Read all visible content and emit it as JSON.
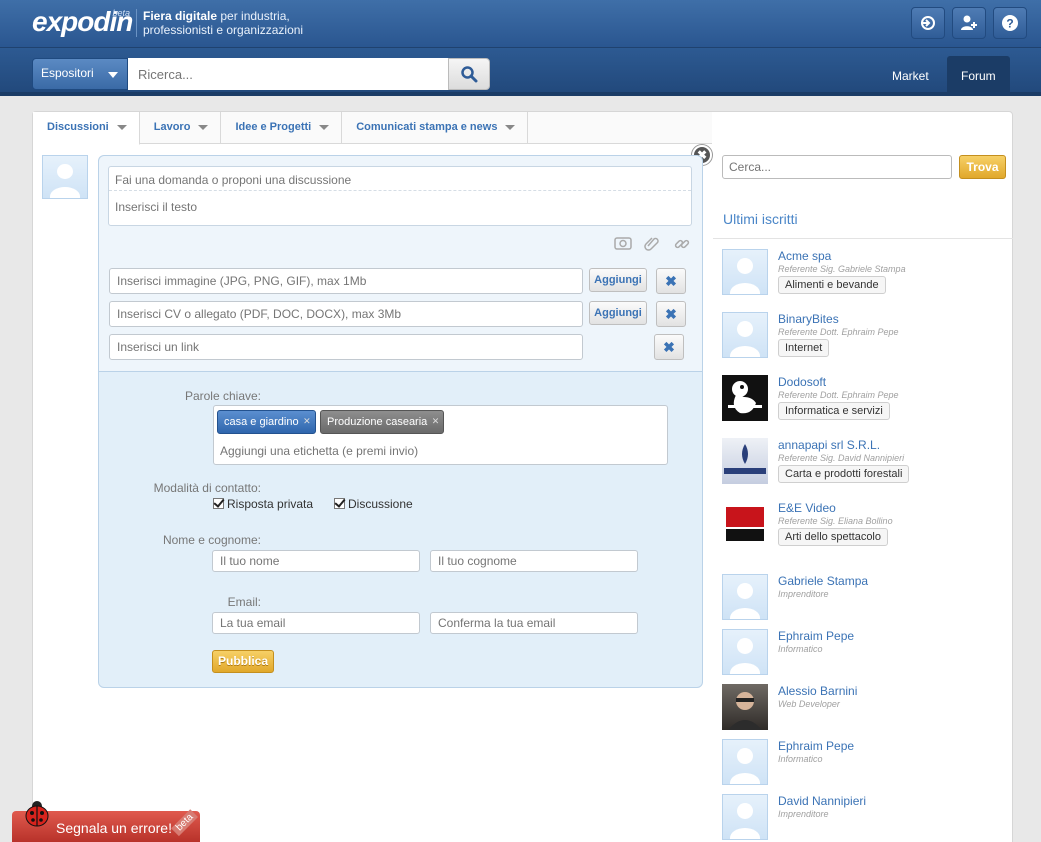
{
  "brand": {
    "logo": "expodin",
    "logo_sup": "beta",
    "tagline_bold": "Fiera digitale",
    "tagline_rest": " per industria, professionisti e organizzazioni"
  },
  "header_icons": [
    "login-icon",
    "add-user-icon",
    "help-icon"
  ],
  "nav": {
    "expo_select": "Espositori",
    "search_placeholder": "Ricerca...",
    "market": "Market",
    "forum": "Forum"
  },
  "tabs": [
    "Discussioni",
    "Lavoro",
    "Idee e Progetti",
    "Comunicati stampa e news"
  ],
  "composer": {
    "title_placeholder": "Fai una domanda o proponi una discussione",
    "body_placeholder": "Inserisci il testo",
    "image_placeholder": "Inserisci immagine (JPG, PNG, GIF), max 1Mb",
    "cv_placeholder": "Inserisci CV o allegato (PDF, DOC, DOCX), max 3Mb",
    "link_placeholder": "Inserisci un link",
    "add_label": "Aggiungi",
    "keywords_label": "Parole chiave:",
    "tags": [
      "casa e giardino",
      "Produzione casearia"
    ],
    "tag_placeholder": "Aggiungi una etichetta (e premi invio)",
    "contact_label": "Modalità di contatto:",
    "contact_private": "Risposta privata",
    "contact_discussion": "Discussione",
    "name_label": "Nome e cognome:",
    "first_name_placeholder": "Il tuo nome",
    "last_name_placeholder": "Il tuo cognome",
    "email_label": "Email:",
    "email_placeholder": "La tua email",
    "email_confirm_placeholder": "Conferma la tua email",
    "publish": "Pubblica"
  },
  "sidebar": {
    "search_placeholder": "Cerca...",
    "search_button": "Trova",
    "title": "Ultimi iscritti",
    "members": [
      {
        "name": "Acme spa",
        "sub": "Referente Sig. Gabriele Stampa",
        "category": "Alimenti e bevande",
        "avatar": "placeholder"
      },
      {
        "name": "BinaryBites",
        "sub": "Referente Dott. Ephraim Pepe",
        "category": "Internet",
        "avatar": "placeholder"
      },
      {
        "name": "Dodosoft",
        "sub": "Referente Dott. Ephraim Pepe",
        "category": "Informatica e servizi",
        "avatar": "dodosoft-logo"
      },
      {
        "name": "annapapi srl S.R.L.",
        "sub": "Referente Sig. David Nannipieri",
        "category": "Carta e prodotti forestali",
        "avatar": "annapapi-logo"
      },
      {
        "name": "E&E Video",
        "sub": "Referente Sig. Eliana Bollino",
        "category": "Arti dello spettacolo",
        "avatar": "ee-video-logo"
      },
      {
        "name": "Gabriele Stampa",
        "sub": "Imprenditore",
        "category": "",
        "avatar": "placeholder"
      },
      {
        "name": "Ephraim Pepe",
        "sub": "Informatico",
        "category": "",
        "avatar": "placeholder"
      },
      {
        "name": "Alessio Barnini",
        "sub": "Web Developer",
        "category": "",
        "avatar": "photo"
      },
      {
        "name": "Ephraim Pepe",
        "sub": "Informatico",
        "category": "",
        "avatar": "placeholder"
      },
      {
        "name": "David Nannipieri",
        "sub": "Imprenditore",
        "category": "",
        "avatar": "placeholder"
      }
    ]
  },
  "bug_report": {
    "label": "Segnala un errore!",
    "badge": "beta"
  }
}
